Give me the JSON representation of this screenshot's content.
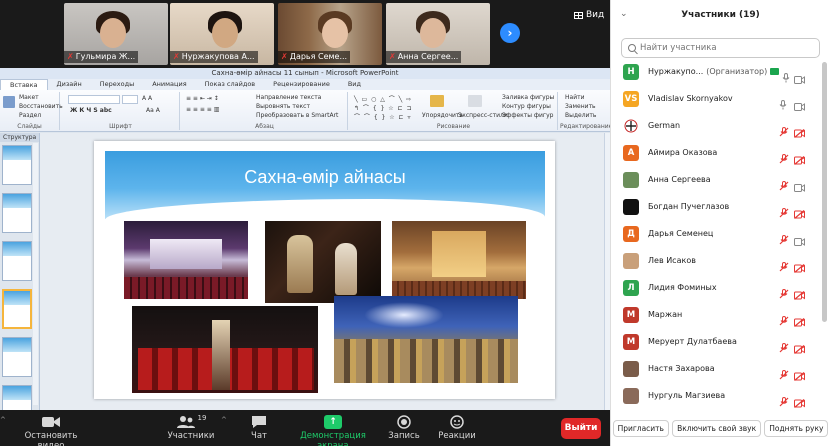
{
  "gallery": {
    "tiles": [
      {
        "name": "Гульмира Ж...",
        "muted": true
      },
      {
        "name": "Нуржакупова А...",
        "muted": true
      },
      {
        "name": "Дарья Семе...",
        "muted": true
      },
      {
        "name": "Анна Сергее...",
        "muted": true
      }
    ],
    "next_icon": "chevron-right-icon",
    "view_label": "Вид"
  },
  "powerpoint": {
    "window_title": "Сахна-өмір айнасы 11 сынып - Microsoft PowerPoint",
    "tabs": [
      "Файл",
      "Вставка",
      "Дизайн",
      "Переходы",
      "Анимация",
      "Показ слайдов",
      "Рецензирование",
      "Вид"
    ],
    "ribbon": {
      "groups": [
        "Слайды",
        "Шрифт",
        "Абзац",
        "Рисование",
        "Редактирование"
      ],
      "items": {
        "maket": "Макет",
        "restore": "Восстановить",
        "section": "Раздел",
        "create_slide": "Создать слайд",
        "text_direction": "Направление текста",
        "align_text": "Выровнять текст",
        "convert_smartart": "Преобразовать в SmartArt",
        "arrange": "Упорядочить",
        "quick_styles": "Экспресс-стили",
        "shape_fill": "Заливка фигуры",
        "shape_outline": "Контур фигуры",
        "shape_effects": "Эффекты фигур",
        "find": "Найти",
        "replace": "Заменить",
        "select": "Выделить"
      }
    },
    "thumbs_label": "Структура",
    "slide": {
      "title": "Сахна-өмір айнасы"
    }
  },
  "toolbar": {
    "stop_video": "Остановить видео",
    "participants": "Участники",
    "participants_count": "19",
    "chat": "Чат",
    "share_screen": "Демонстрация экрана",
    "record": "Запись",
    "reactions": "Реакции",
    "end": "Выйти"
  },
  "participants_panel": {
    "title": "Участники (19)",
    "search_placeholder": "Найти участника",
    "list": [
      {
        "name": "Нуржакупо...",
        "role": "(Организатор)",
        "avatar_letter": "Н",
        "avatar_color": "#2ea44f",
        "mic": "on",
        "cam": "on",
        "host": true
      },
      {
        "name": "Vladislav Skornyakov",
        "role": "",
        "avatar_letter": "VS",
        "avatar_color": "#f5a623",
        "mic": "on",
        "cam": "on",
        "host": false
      },
      {
        "name": "German",
        "role": "",
        "avatar_letter": "",
        "avatar_color": "#ffffff",
        "mic": "off",
        "cam": "off",
        "host": false
      },
      {
        "name": "Аймира Оказова",
        "role": "",
        "avatar_letter": "А",
        "avatar_color": "#e8681f",
        "mic": "off",
        "cam": "off",
        "host": false
      },
      {
        "name": "Анна Сергеева",
        "role": "",
        "avatar_letter": "",
        "avatar_color": "#6b8e5a",
        "mic": "off",
        "cam": "on",
        "host": false
      },
      {
        "name": "Богдан Пучеглазов",
        "role": "",
        "avatar_letter": "",
        "avatar_color": "#111111",
        "mic": "off",
        "cam": "off",
        "host": false
      },
      {
        "name": "Дарья Семенец",
        "role": "",
        "avatar_letter": "Д",
        "avatar_color": "#e8681f",
        "mic": "off",
        "cam": "on",
        "host": false
      },
      {
        "name": "Лев Исаков",
        "role": "",
        "avatar_letter": "",
        "avatar_color": "#c9a07a",
        "mic": "off",
        "cam": "off",
        "host": false
      },
      {
        "name": "Лидия Фоминых",
        "role": "",
        "avatar_letter": "Л",
        "avatar_color": "#2ea44f",
        "mic": "off",
        "cam": "off",
        "host": false
      },
      {
        "name": "Маржан",
        "role": "",
        "avatar_letter": "М",
        "avatar_color": "#c0392b",
        "mic": "off",
        "cam": "off",
        "host": false
      },
      {
        "name": "Меруерт Дулатбаева",
        "role": "",
        "avatar_letter": "М",
        "avatar_color": "#c0392b",
        "mic": "off",
        "cam": "off",
        "host": false
      },
      {
        "name": "Настя Захарова",
        "role": "",
        "avatar_letter": "",
        "avatar_color": "#7a5c4a",
        "mic": "off",
        "cam": "off",
        "host": false
      },
      {
        "name": "Нургуль Магзиева",
        "role": "",
        "avatar_letter": "",
        "avatar_color": "#8a6a5a",
        "mic": "off",
        "cam": "off",
        "host": false
      }
    ],
    "footer": {
      "invite": "Пригласить",
      "unmute": "Включить свой звук",
      "raise_hand": "Поднять руку"
    }
  },
  "colors": {
    "muted_red": "#e53935",
    "accent_blue": "#2d8cff",
    "share_green": "#1ecb6a",
    "end_red": "#e02828"
  }
}
